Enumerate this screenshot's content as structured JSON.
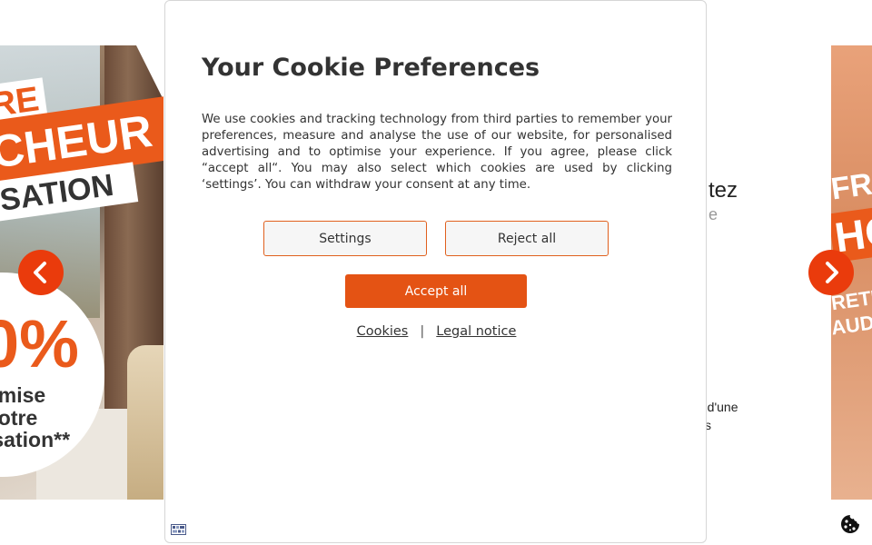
{
  "background": {
    "left_slide": {
      "banner_top": "RE",
      "banner_main": "CHEUR",
      "banner_sub": "ISATION",
      "promo_percent": "0%",
      "promo_line1": "emise",
      "promo_line2": "votre",
      "promo_line3": "isation**"
    },
    "right_slide": {
      "line1": "FRE",
      "line2": "HO",
      "line3": "RETI",
      "line4": "AUDI"
    },
    "peek": {
      "heading_fragment": "tez",
      "sub_fragment": "e",
      "body_fragment1": "ez d'une",
      "body_fragment2": "s"
    },
    "prev_icon": "chevron-left-icon",
    "next_icon": "chevron-right-icon",
    "cookie_icon": "cookie-icon",
    "accent_color": "#ea3b0c"
  },
  "modal": {
    "title": "Your Cookie Preferences",
    "body": "We use cookies and tracking technology from third parties to remember your preferences, measure and analyse the use of our website, for personalised advertising and to optimise your experience. If you agree, please click “accept all“. You may also select which cookies are used by clicking ‘settings’. You can withdraw your consent at any time.",
    "settings_label": "Settings",
    "reject_label": "Reject all",
    "accept_label": "Accept all",
    "cookies_link": "Cookies",
    "separator": "|",
    "legal_link": "Legal notice",
    "logo_icon": "consent-manager-logo-icon",
    "accent_color": "#e45314"
  }
}
